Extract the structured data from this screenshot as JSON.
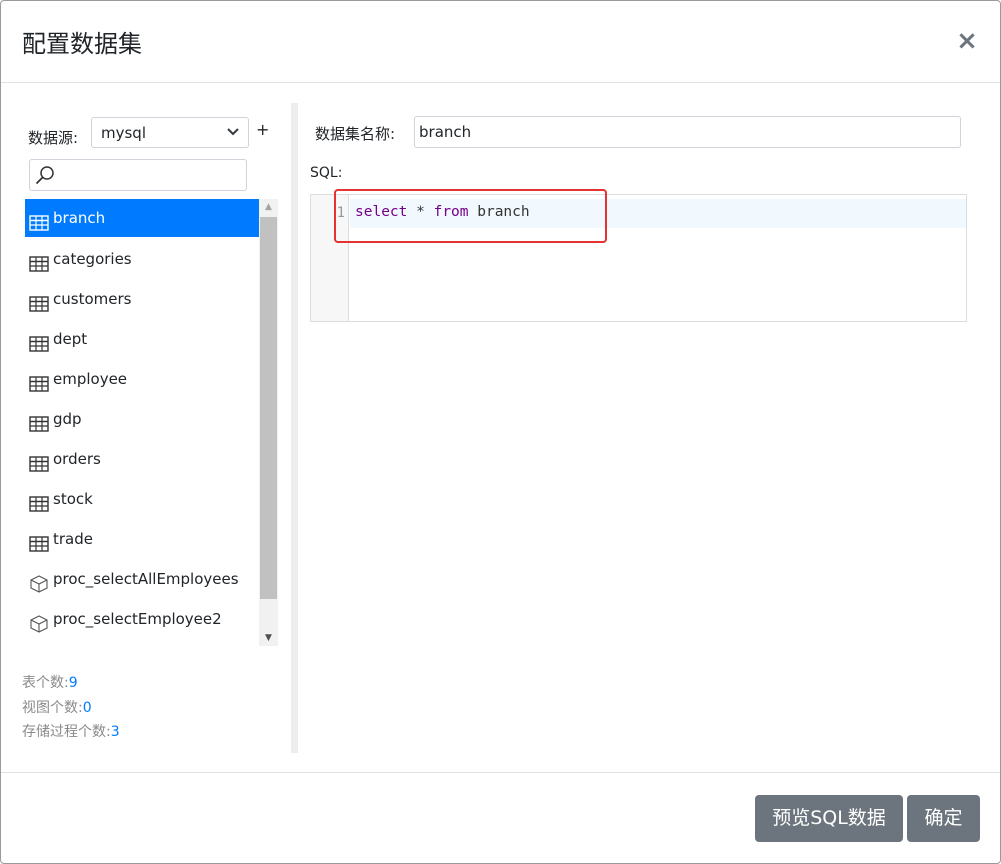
{
  "dialog": {
    "title": "配置数据集",
    "close_label": "×"
  },
  "datasource": {
    "label": "数据源:",
    "selected": "mysql",
    "add_label": "+"
  },
  "search": {
    "placeholder": ""
  },
  "tables": [
    {
      "name": "branch",
      "type": "table",
      "active": true
    },
    {
      "name": "categories",
      "type": "table"
    },
    {
      "name": "customers",
      "type": "table"
    },
    {
      "name": "dept",
      "type": "table"
    },
    {
      "name": "employee",
      "type": "table"
    },
    {
      "name": "gdp",
      "type": "table"
    },
    {
      "name": "orders",
      "type": "table"
    },
    {
      "name": "stock",
      "type": "table"
    },
    {
      "name": "trade",
      "type": "table"
    },
    {
      "name": "proc_selectAllEmployees",
      "type": "procedure"
    },
    {
      "name": "proc_selectEmployee2",
      "type": "procedure"
    }
  ],
  "stats": {
    "tables_label": "表个数:",
    "tables_count": "9",
    "views_label": "视图个数:",
    "views_count": "0",
    "procs_label": "存储过程个数:",
    "procs_count": "3"
  },
  "dataset": {
    "name_label": "数据集名称:",
    "name_value": "branch"
  },
  "sql": {
    "label": "SQL:",
    "line_number": "1",
    "tokens": {
      "kw1": "select",
      "op": " * ",
      "kw2": "from",
      "ident": " branch"
    }
  },
  "footer": {
    "preview_label": "预览SQL数据",
    "ok_label": "确定"
  },
  "colors": {
    "accent": "#007bff",
    "button": "#6c757d",
    "highlight": "#e53333",
    "keyword": "#770088"
  }
}
